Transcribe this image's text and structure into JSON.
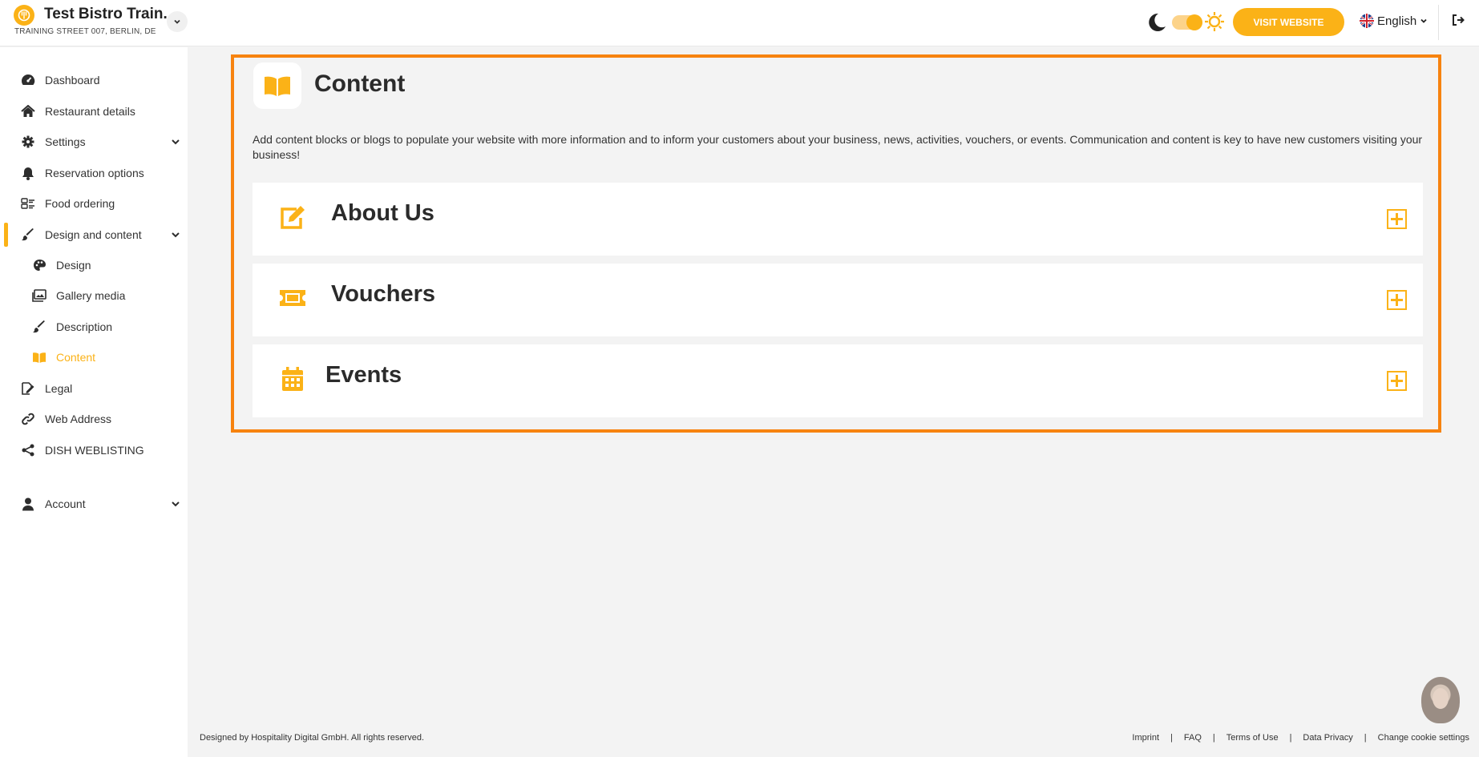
{
  "header": {
    "restaurant_name": "Test Bistro Train..",
    "restaurant_address": "TRAINING STREET 007, BERLIN, DE",
    "visit_website": "VISIT WEBSITE",
    "language": "English"
  },
  "sidebar": {
    "items": [
      {
        "label": "Dashboard",
        "icon": "dashboard-icon"
      },
      {
        "label": "Restaurant details",
        "icon": "home-icon"
      },
      {
        "label": "Settings",
        "icon": "gear-icon"
      },
      {
        "label": "Reservation options",
        "icon": "bell-icon"
      },
      {
        "label": "Food ordering",
        "icon": "food-ordering-icon"
      },
      {
        "label": "Design and content",
        "icon": "brush-icon"
      },
      {
        "label": "Design",
        "icon": "palette-icon"
      },
      {
        "label": "Gallery media",
        "icon": "images-icon"
      },
      {
        "label": "Description",
        "icon": "brush-icon"
      },
      {
        "label": "Content",
        "icon": "book-icon"
      },
      {
        "label": "Legal",
        "icon": "signature-icon"
      },
      {
        "label": "Web Address",
        "icon": "link-icon"
      },
      {
        "label": "DISH WEBLISTING",
        "icon": "share-icon"
      },
      {
        "label": "Account",
        "icon": "user-icon"
      }
    ]
  },
  "main": {
    "title": "Content",
    "description": "Add content blocks or blogs to populate your website with more information and to inform your customers about your business, news, activities, vouchers, or events. Communication and content is key to have new customers visiting your business!",
    "sections": [
      {
        "title": "About Us",
        "icon": "edit-icon"
      },
      {
        "title": "Vouchers",
        "icon": "ticket-icon"
      },
      {
        "title": "Events",
        "icon": "calendar-icon"
      }
    ]
  },
  "footer": {
    "copyright": "Designed by Hospitality Digital GmbH. All rights reserved.",
    "links": [
      "Imprint",
      "FAQ",
      "Terms of Use",
      "Data Privacy",
      "Change cookie settings"
    ]
  },
  "colors": {
    "accent": "#fbb217",
    "highlight_border": "#f7830f",
    "background": "#f3f3f3"
  }
}
